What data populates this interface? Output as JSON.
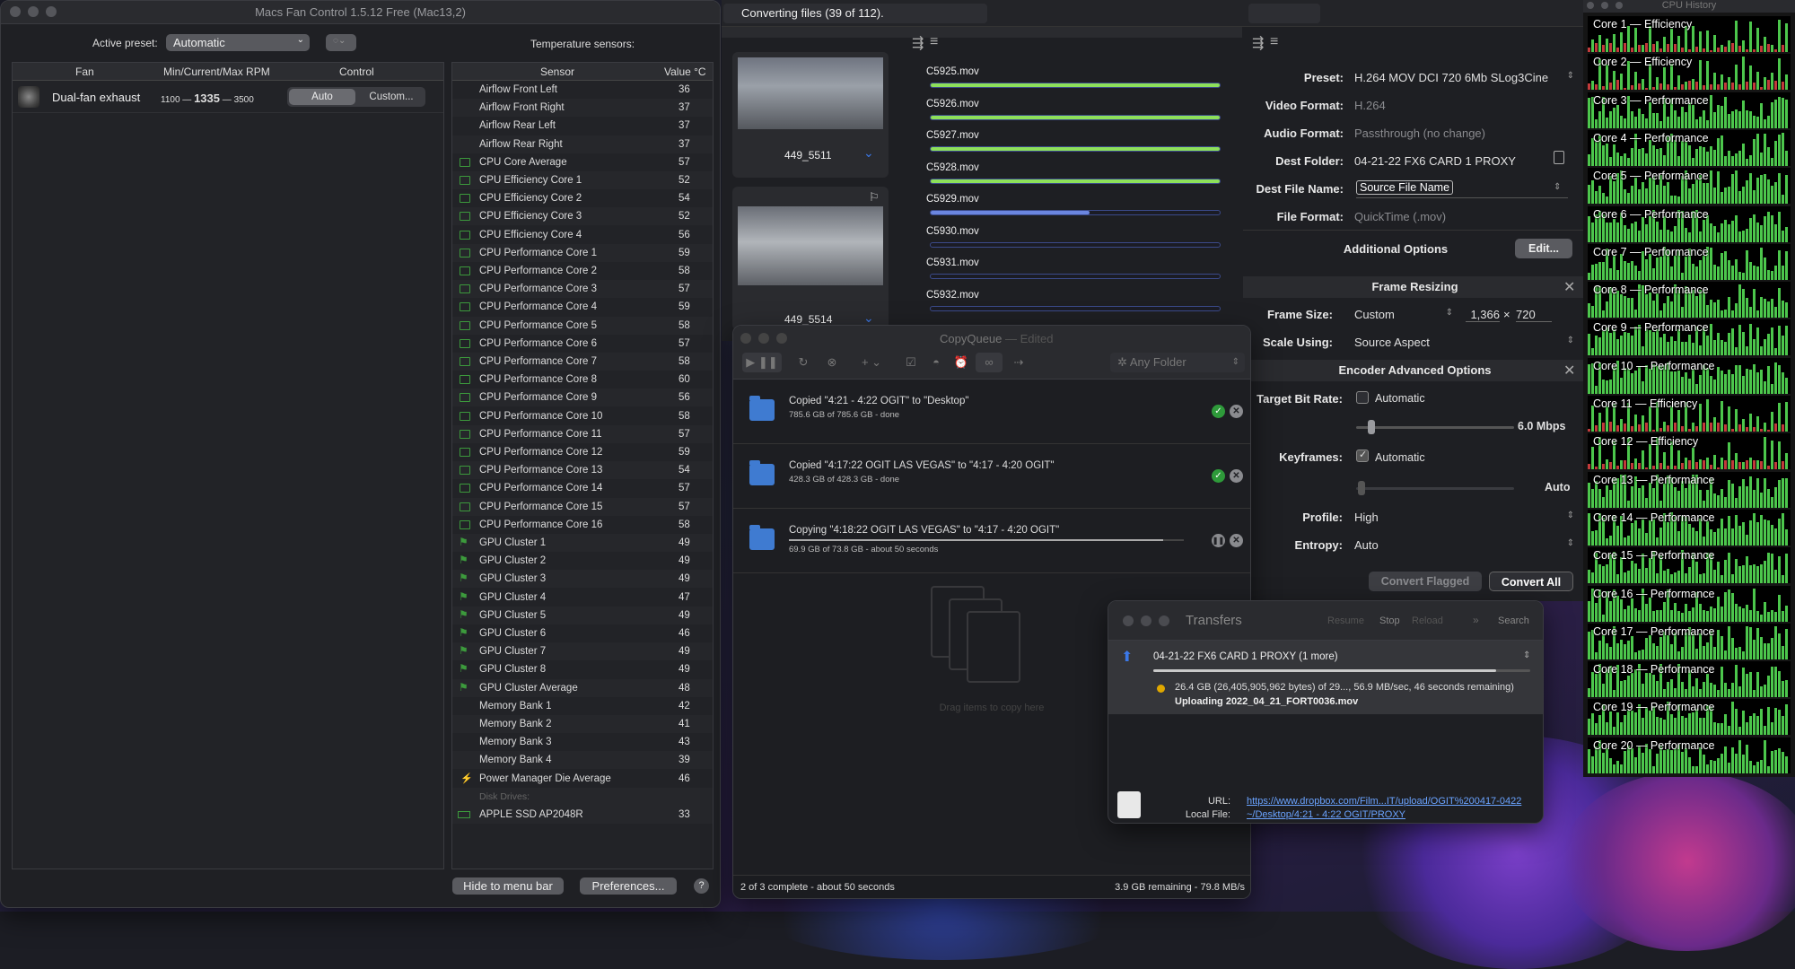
{
  "macs_fan_control": {
    "title": "Macs Fan Control 1.5.12 Free (Mac13,2)",
    "active_preset_label": "Active preset:",
    "active_preset_value": "Automatic",
    "temperature_label": "Temperature sensors:",
    "fan_columns": [
      "Fan",
      "Min/Current/Max RPM",
      "Control"
    ],
    "fan": {
      "name": "Dual-fan exhaust",
      "min": "1100",
      "current": "1335",
      "max": "3500",
      "auto": "Auto",
      "custom": "Custom..."
    },
    "sensor_header": "Sensor",
    "value_header": "Value °C",
    "sensors": [
      {
        "name": "Airflow Front Left",
        "value": "36",
        "icon": "none"
      },
      {
        "name": "Airflow Front Right",
        "value": "37",
        "icon": "none"
      },
      {
        "name": "Airflow Rear Left",
        "value": "37",
        "icon": "none"
      },
      {
        "name": "Airflow Rear Right",
        "value": "37",
        "icon": "none"
      },
      {
        "name": "CPU Core Average",
        "value": "57",
        "icon": "chip"
      },
      {
        "name": "CPU Efficiency Core 1",
        "value": "52",
        "icon": "chip"
      },
      {
        "name": "CPU Efficiency Core 2",
        "value": "54",
        "icon": "chip"
      },
      {
        "name": "CPU Efficiency Core 3",
        "value": "52",
        "icon": "chip"
      },
      {
        "name": "CPU Efficiency Core 4",
        "value": "56",
        "icon": "chip"
      },
      {
        "name": "CPU Performance Core 1",
        "value": "59",
        "icon": "chip"
      },
      {
        "name": "CPU Performance Core 2",
        "value": "58",
        "icon": "chip"
      },
      {
        "name": "CPU Performance Core 3",
        "value": "57",
        "icon": "chip"
      },
      {
        "name": "CPU Performance Core 4",
        "value": "59",
        "icon": "chip"
      },
      {
        "name": "CPU Performance Core 5",
        "value": "58",
        "icon": "chip"
      },
      {
        "name": "CPU Performance Core 6",
        "value": "57",
        "icon": "chip"
      },
      {
        "name": "CPU Performance Core 7",
        "value": "58",
        "icon": "chip"
      },
      {
        "name": "CPU Performance Core 8",
        "value": "60",
        "icon": "chip"
      },
      {
        "name": "CPU Performance Core 9",
        "value": "56",
        "icon": "chip"
      },
      {
        "name": "CPU Performance Core 10",
        "value": "58",
        "icon": "chip"
      },
      {
        "name": "CPU Performance Core 11",
        "value": "57",
        "icon": "chip"
      },
      {
        "name": "CPU Performance Core 12",
        "value": "59",
        "icon": "chip"
      },
      {
        "name": "CPU Performance Core 13",
        "value": "54",
        "icon": "chip"
      },
      {
        "name": "CPU Performance Core 14",
        "value": "57",
        "icon": "chip"
      },
      {
        "name": "CPU Performance Core 15",
        "value": "57",
        "icon": "chip"
      },
      {
        "name": "CPU Performance Core 16",
        "value": "58",
        "icon": "chip"
      },
      {
        "name": "GPU Cluster 1",
        "value": "49",
        "icon": "gpu"
      },
      {
        "name": "GPU Cluster 2",
        "value": "49",
        "icon": "gpu"
      },
      {
        "name": "GPU Cluster 3",
        "value": "49",
        "icon": "gpu"
      },
      {
        "name": "GPU Cluster 4",
        "value": "47",
        "icon": "gpu"
      },
      {
        "name": "GPU Cluster 5",
        "value": "49",
        "icon": "gpu"
      },
      {
        "name": "GPU Cluster 6",
        "value": "46",
        "icon": "gpu"
      },
      {
        "name": "GPU Cluster 7",
        "value": "49",
        "icon": "gpu"
      },
      {
        "name": "GPU Cluster 8",
        "value": "49",
        "icon": "gpu"
      },
      {
        "name": "GPU Cluster Average",
        "value": "48",
        "icon": "gpu"
      },
      {
        "name": "Memory Bank 1",
        "value": "42",
        "icon": "none"
      },
      {
        "name": "Memory Bank 2",
        "value": "41",
        "icon": "none"
      },
      {
        "name": "Memory Bank 3",
        "value": "43",
        "icon": "none"
      },
      {
        "name": "Memory Bank 4",
        "value": "39",
        "icon": "none"
      },
      {
        "name": "Power Manager Die Average",
        "value": "46",
        "icon": "bolt"
      }
    ],
    "disk_drives_label": "Disk Drives:",
    "disk": {
      "name": "APPLE SSD AP2048R",
      "value": "33"
    },
    "hide_button": "Hide to menu bar",
    "prefs_button": "Preferences...",
    "help_button": "?"
  },
  "encoder": {
    "status": "Converting files (39 of 112).",
    "thumbs": [
      {
        "label": "449_5511"
      },
      {
        "label": "449_5514"
      }
    ],
    "files": [
      {
        "name": "C5925.mov",
        "progress": 1.0,
        "state": "done"
      },
      {
        "name": "C5926.mov",
        "progress": 1.0,
        "state": "done"
      },
      {
        "name": "C5927.mov",
        "progress": 1.0,
        "state": "done"
      },
      {
        "name": "C5928.mov",
        "progress": 1.0,
        "state": "done"
      },
      {
        "name": "C5929.mov",
        "progress": 0.55,
        "state": "active"
      },
      {
        "name": "C5930.mov",
        "progress": 0,
        "state": "queued"
      },
      {
        "name": "C5931.mov",
        "progress": 0,
        "state": "queued"
      },
      {
        "name": "C5932.mov",
        "progress": 0,
        "state": "queued"
      }
    ]
  },
  "settings": {
    "preset_label": "Preset:",
    "preset": "H.264 MOV DCI 720 6Mb SLog3Cine",
    "video_label": "Video Format:",
    "video": "H.264",
    "audio_label": "Audio Format:",
    "audio": "Passthrough (no change)",
    "dest_label": "Dest Folder:",
    "dest": "04-21-22 FX6 CARD 1 PROXY",
    "destname_label": "Dest File Name:",
    "destname": "Source File Name",
    "fileformat_label": "File Format:",
    "fileformat": "QuickTime (.mov)",
    "additional": "Additional Options",
    "edit": "Edit...",
    "frame_resizing": "Frame Resizing",
    "framesize_label": "Frame Size:",
    "framesize": "Custom",
    "width": "1,366",
    "x": "×",
    "height": "720",
    "scale_label": "Scale Using:",
    "scale": "Source Aspect",
    "encoder_adv": "Encoder Advanced Options",
    "bitrate_label": "Target Bit Rate:",
    "automatic": "Automatic",
    "bitrate": "6.0 Mbps",
    "keyframes_label": "Keyframes:",
    "keyframes_auto": "Automatic",
    "keyframes_val": "Auto",
    "profile_label": "Profile:",
    "profile": "High",
    "entropy_label": "Entropy:",
    "entropy": "Auto",
    "convert_flagged": "Convert Flagged",
    "convert_all": "Convert All"
  },
  "cpu_history": {
    "title": "CPU History",
    "cores": [
      "Core 1 — Efficiency",
      "Core 2 — Efficiency",
      "Core 3 — Performance",
      "Core 4 — Performance",
      "Core 5 — Performance",
      "Core 6 — Performance",
      "Core 7 — Performance",
      "Core 8 — Performance",
      "Core 9 — Performance",
      "Core 10 — Performance",
      "Core 11 — Efficiency",
      "Core 12 — Efficiency",
      "Core 13 — Performance",
      "Core 14 — Performance",
      "Core 15 — Performance",
      "Core 16 — Performance",
      "Core 17 — Performance",
      "Core 18 — Performance",
      "Core 19 — Performance",
      "Core 20 — Performance"
    ]
  },
  "copyqueue": {
    "title": "CopyQueue",
    "edited": "— Edited",
    "folder": "Any Folder",
    "items": [
      {
        "title": "Copied \"4:21 - 4:22 OGIT\" to \"Desktop\"",
        "sub": "785.6 GB of 785.6 GB - done",
        "state": "done",
        "progress": 1.0
      },
      {
        "title": "Copied \"4:17:22 OGIT LAS VEGAS\" to \"4:17 - 4:20 OGIT\"",
        "sub": "428.3 GB of 428.3 GB - done",
        "state": "done",
        "progress": 1.0
      },
      {
        "title": "Copying \"4:18:22 OGIT LAS VEGAS\" to \"4:17 - 4:20 OGIT\"",
        "sub": "69.9 GB of 73.8 GB - about 50 seconds",
        "state": "copying",
        "progress": 0.947
      }
    ],
    "drag_hint": "Drag items to copy here",
    "status_left": "2 of 3 complete - about 50 seconds",
    "status_right": "3.9 GB remaining - 79.8 MB/s"
  },
  "transfers": {
    "title": "Transfers",
    "resume": "Resume",
    "stop": "Stop",
    "reload": "Reload",
    "search": "Search",
    "job": "04-21-22 FX6 CARD 1 PROXY (1 more)",
    "detail": "26.4 GB (26,405,905,962 bytes) of 29..., 56.9 MB/sec, 46 seconds remaining)",
    "uploading": "Uploading 2022_04_21_FORT0036.mov",
    "url_label": "URL:",
    "url": "https://www.dropbox.com/Film...IT/upload/OGIT%200417-0422",
    "local_label": "Local File:",
    "local": "~/Desktop/4:21 - 4:22 OGIT/PROXY"
  }
}
